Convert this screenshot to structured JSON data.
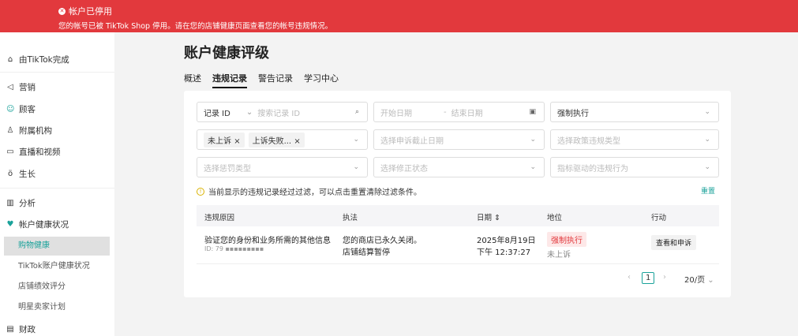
{
  "banner": {
    "title": "帐户已停用",
    "desc": "您的帐号已被 TikTok Shop 停用。请在您的店铺健康页面查看您的帐号违规情况。"
  },
  "sidebar": {
    "items": [
      {
        "label": "由TikTok完成",
        "icon": "warehouse-icon"
      },
      {
        "label": "营销",
        "icon": "megaphone-icon"
      },
      {
        "label": "顾客",
        "icon": "customers-icon"
      },
      {
        "label": "附属机构",
        "icon": "affiliate-icon"
      },
      {
        "label": "直播和视频",
        "icon": "video-icon"
      },
      {
        "label": "生长",
        "icon": "growth-icon"
      },
      {
        "label": "分析",
        "icon": "analytics-icon"
      },
      {
        "label": "帐户健康状况",
        "icon": "health-icon"
      },
      {
        "label": "财政",
        "icon": "finance-icon"
      }
    ],
    "sub": [
      "购物健康",
      "TikTok账户健康状况",
      "店铺绩效评分",
      "明星卖家计划"
    ]
  },
  "page": {
    "title": "账户健康评级",
    "tabs": [
      "概述",
      "违规记录",
      "警告记录",
      "学习中心"
    ],
    "active_tab": 1
  },
  "filters": {
    "record_type": "记录 ID",
    "search_placeholder": "搜索记录 ID",
    "start": "开始日期",
    "end": "结束日期",
    "enforcement": "强制执行",
    "tags": [
      "未上诉",
      "上诉失败..."
    ],
    "appeal_deadline": "选择申诉截止日期",
    "policy_type": "选择政策违规类型",
    "penalty_type": "选择惩罚类型",
    "fix_status": "选择修正状态",
    "metric": "指标驱动的违规行为"
  },
  "notice": "当前显示的违规记录经过过滤，可以点击重置清除过滤条件。",
  "reset": "重置",
  "table": {
    "headers": [
      "违规原因",
      "执法",
      "日期",
      "地位",
      "行动"
    ],
    "rows": [
      {
        "reason": "验证您的身份和业务所需的其他信息",
        "id": "ID: 79 ▪▪▪▪▪▪▪▪▪",
        "enforce1": "您的商店已永久关闭。",
        "enforce2": "店铺结算暂停",
        "date1": "2025年8月19日",
        "date2": "下午 12:37:27",
        "status": "强制执行",
        "appeal": "未上诉",
        "action": "查看和申诉"
      }
    ]
  },
  "pagination": {
    "page": "1",
    "per_page": "20/页"
  },
  "colors": {
    "banner": "#e2393d",
    "accent": "#1aa29a"
  }
}
